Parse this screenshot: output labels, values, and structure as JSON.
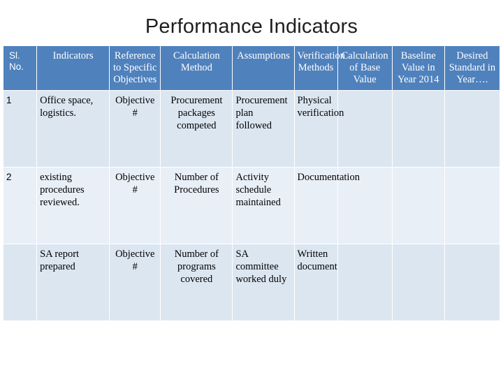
{
  "slide": {
    "title": "Performance Indicators"
  },
  "table": {
    "headers": [
      "Sl. No.",
      "Indicators",
      "Reference to Specific Objectives",
      "Calculation Method",
      "Assumptions",
      "Verification Methods",
      "Calculation of Base Value",
      "Baseline Value in Year 2014",
      "Desired Standard in Year…."
    ],
    "rows": [
      {
        "sl_no": "1",
        "indicators": "Office space, logistics.",
        "reference": "Objective #",
        "calculation": "Procurement packages competed",
        "assumptions": "Procurement plan followed",
        "verification": "Physical verification",
        "calc_base": "",
        "baseline": "",
        "desired": ""
      },
      {
        "sl_no": "2",
        "indicators": "existing procedures reviewed.",
        "reference": "Objective #",
        "calculation": "Number of Procedures",
        "assumptions": "Activity schedule maintained",
        "verification": "Documentation",
        "calc_base": "",
        "baseline": "",
        "desired": ""
      },
      {
        "sl_no": "",
        "indicators": "SA report prepared",
        "reference": "Objective #",
        "calculation": "Number of programs covered",
        "assumptions": "SA committee worked duly",
        "verification": "Written document",
        "calc_base": "",
        "baseline": "",
        "desired": ""
      }
    ]
  }
}
